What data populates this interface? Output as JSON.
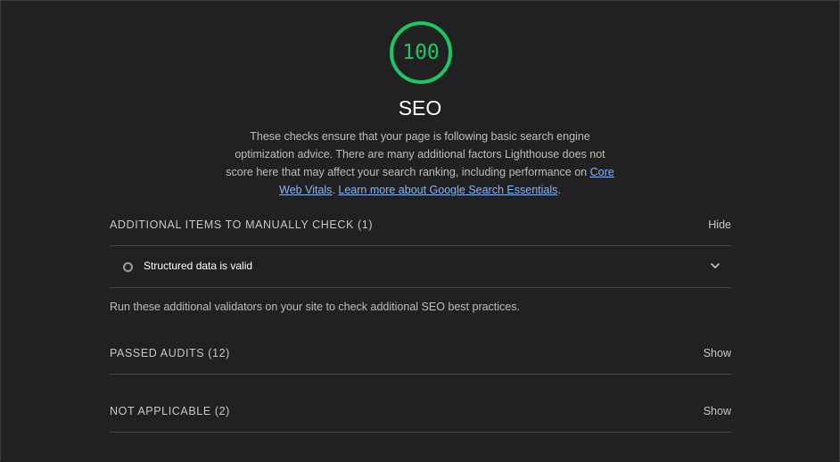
{
  "score": {
    "value": "100",
    "fraction": 1.0,
    "color": "#18c964"
  },
  "category": {
    "title": "SEO",
    "description_parts": {
      "text1": "These checks ensure that your page is following basic search engine optimization advice. There are many additional factors Lighthouse does not score here that may affect your search ranking, including performance on ",
      "link1": "Core Web Vitals",
      "sep": ". ",
      "link2": "Learn more about Google Search Essentials",
      "end": "."
    }
  },
  "manual": {
    "header": "ADDITIONAL ITEMS TO MANUALLY CHECK (1)",
    "toggle": "Hide",
    "items": [
      {
        "label": "Structured data is valid",
        "icon": "chevron-down-icon"
      }
    ],
    "note": "Run these additional validators on your site to check additional SEO best practices."
  },
  "passed": {
    "header": "PASSED AUDITS (12)",
    "toggle": "Show"
  },
  "not_applicable": {
    "header": "NOT APPLICABLE (2)",
    "toggle": "Show"
  },
  "colors": {
    "background": "#212121",
    "pass": "#18c964",
    "link": "#8ab4f8"
  }
}
